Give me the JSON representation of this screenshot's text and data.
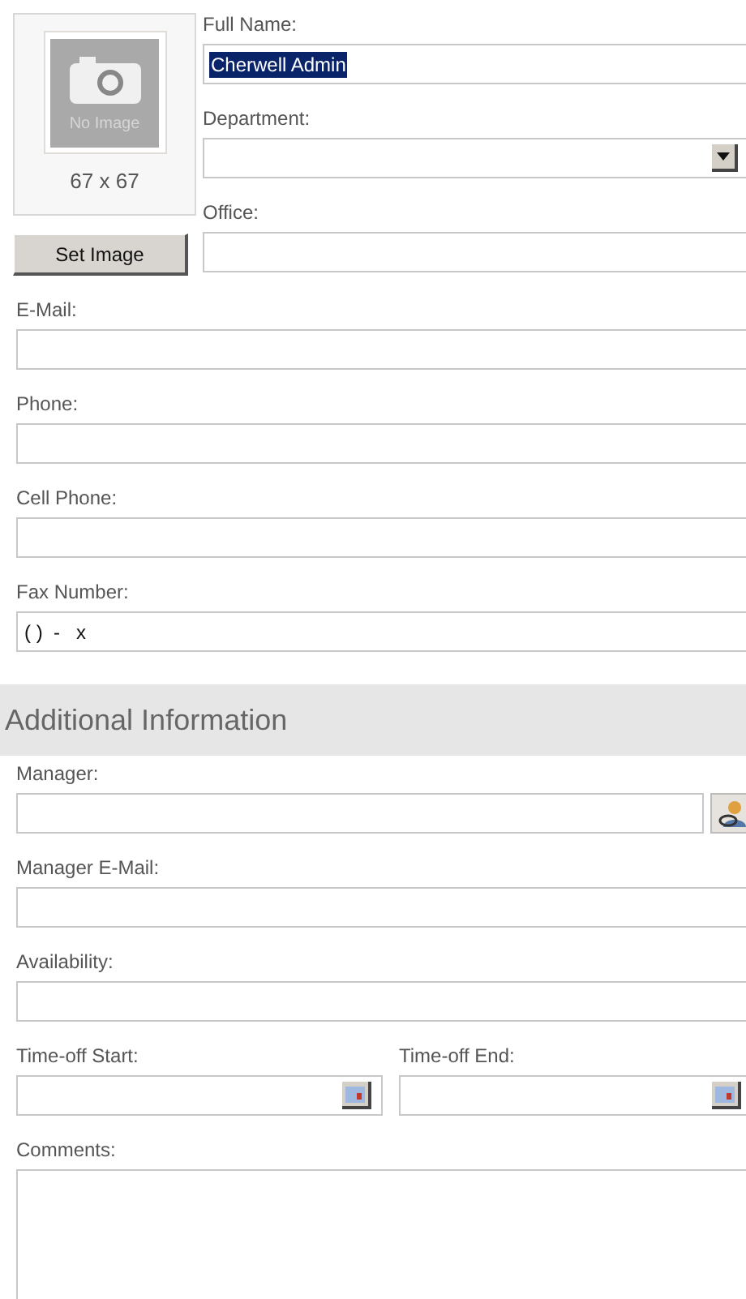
{
  "photo": {
    "caption": "No Image",
    "size": "67 x 67",
    "button": "Set Image"
  },
  "top_fields": [
    {
      "label": "Full Name:",
      "value": "Cherwell Admin",
      "selected": true
    },
    {
      "label": "Department:",
      "kind": "select"
    },
    {
      "label": "Office:"
    }
  ],
  "fields": [
    {
      "label": "E-Mail:"
    },
    {
      "label": "Phone:"
    },
    {
      "label": "Cell Phone:"
    },
    {
      "label": "Fax Number:",
      "value": "( )  -   x"
    }
  ],
  "section": {
    "title": "Additional Information"
  },
  "additional_fields": [
    {
      "label": "Manager:",
      "kind": "lookup"
    },
    {
      "label": "Manager  E-Mail:"
    },
    {
      "label": "Availability:"
    }
  ],
  "date_fields": [
    {
      "label": "Time-off Start:",
      "kind": "date"
    },
    {
      "label": "Time-off End:",
      "kind": "date"
    }
  ],
  "comments": {
    "label": "Comments:"
  }
}
